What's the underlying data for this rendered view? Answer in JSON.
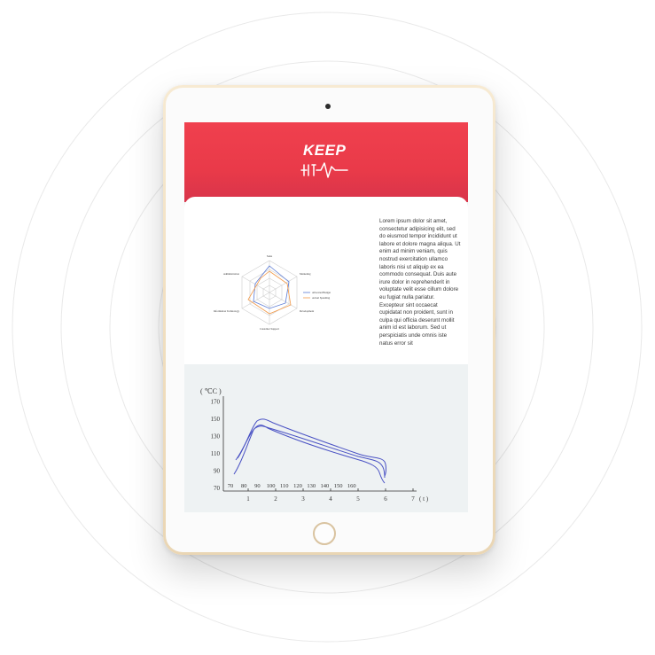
{
  "brand": {
    "logo_word": "KEEP",
    "accent": "#f0404e"
  },
  "radar": {
    "axes": [
      "Sales",
      "Marketing",
      "Development",
      "Customer Support",
      "Information Technology",
      "Administration"
    ],
    "legend": [
      "Allocated Budget",
      "Actual Spending"
    ],
    "series_colors": [
      "#5b7bd5",
      "#f29a4a"
    ]
  },
  "body_text": "Lorem ipsum dolor sit amet, consectetur adipisicing elit, sed do eiusmod tempor incididunt ut labore et dolore magna aliqua. Ut enim ad minim veniam, quis nostrud exercitation ullamco laboris nisi ut aliquip ex ea commodo consequat. Duis aute irure dolor in reprehenderit in voluptate velit esse cillum dolore eu fugiat nulla pariatur. Excepteur sint occaecat cupidatat non proident, sunt in culpa qui officia deserunt mollit anim id est laborum. Sed ut perspiciatis unde omnis iste natus error sit",
  "chart_data": {
    "type": "line",
    "ylabel": "( ℃C )",
    "xlabel": "( t )",
    "y_ticks": [
      "170",
      "150",
      "130",
      "110",
      "90",
      "70"
    ],
    "x_ticks": [
      "1",
      "2",
      "3",
      "4",
      "5",
      "6",
      "7"
    ],
    "secondary_ticks": [
      "70",
      "80",
      "90",
      "100",
      "110",
      "120",
      "130",
      "140",
      "150",
      "160"
    ],
    "series_color": "#4a52c4"
  }
}
